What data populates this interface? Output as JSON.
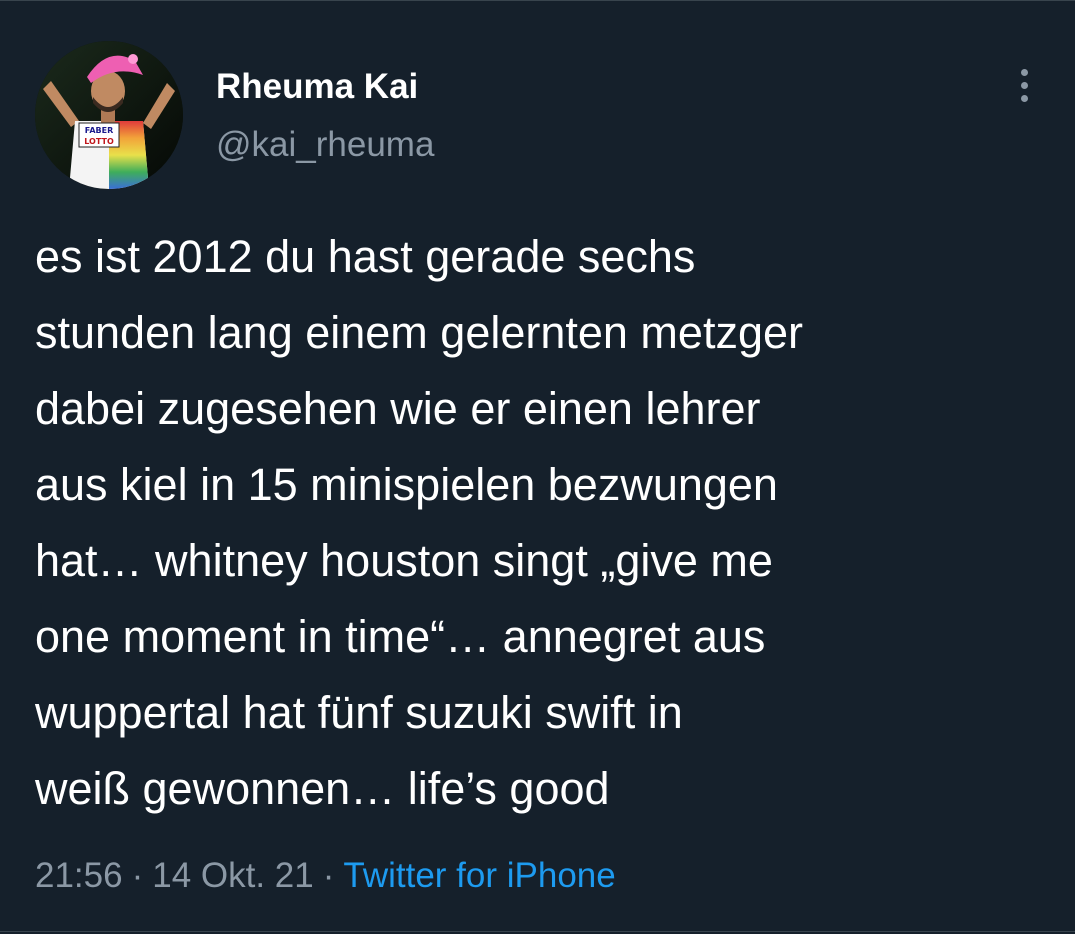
{
  "tweet": {
    "author": {
      "display_name": "Rheuma Kai",
      "handle": "@kai_rheuma",
      "avatar_shirt_text_1": "FABER",
      "avatar_shirt_text_2": "LOTTO"
    },
    "more_icon": "more-vertical-icon",
    "text_lines": [
      "es ist 2012 du hast gerade sechs",
      "stunden lang einem gelernten metzger",
      "dabei zugesehen wie er einen lehrer",
      "aus kiel in 15 minispielen bezwungen",
      "hat… whitney houston singt „give me",
      "one moment in time“… annegret aus",
      "wuppertal hat fünf suzuki swift in",
      "weiß gewonnen… life’s good"
    ],
    "meta": {
      "time": "21:56",
      "separator": "·",
      "date": "14 Okt. 21",
      "source": "Twitter for iPhone"
    }
  },
  "colors": {
    "background": "#15202b",
    "text": "#ffffff",
    "secondary": "#8b98a5",
    "link": "#1d9bf0",
    "border": "#38444d"
  }
}
